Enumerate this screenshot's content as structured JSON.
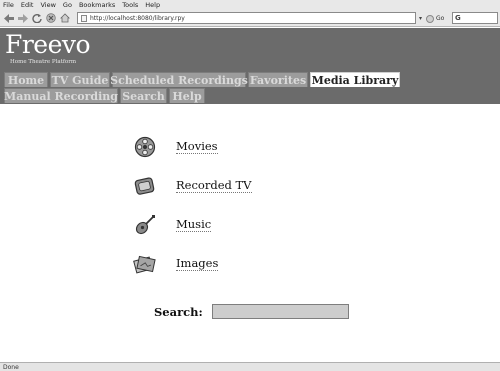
{
  "browser": {
    "menu": [
      "File",
      "Edit",
      "View",
      "Go",
      "Bookmarks",
      "Tools",
      "Help"
    ],
    "url": "http://localhost:8080/library.rpy",
    "go_label": "Go",
    "search_logo": "G",
    "status": "Done",
    "nav_icons": [
      "back-arrow-icon",
      "forward-arrow-icon",
      "reload-icon",
      "stop-icon",
      "home-icon"
    ]
  },
  "header": {
    "logo": "Freevo",
    "tagline": "Home Theatre Platform",
    "tabs_row1": [
      {
        "label": "Home",
        "active": false
      },
      {
        "label": "TV Guide",
        "active": false
      },
      {
        "label": "Scheduled Recordings",
        "active": false
      },
      {
        "label": "Favorites",
        "active": false
      },
      {
        "label": "Media Library",
        "active": true
      }
    ],
    "tabs_row2": [
      {
        "label": "Manual Recording",
        "active": false
      },
      {
        "label": "Search",
        "active": false
      },
      {
        "label": "Help",
        "active": false
      }
    ]
  },
  "library": {
    "items": [
      {
        "label": "Movies",
        "icon": "film-reel-icon"
      },
      {
        "label": "Recorded TV",
        "icon": "television-icon"
      },
      {
        "label": "Music",
        "icon": "guitar-icon"
      },
      {
        "label": "Images",
        "icon": "photos-icon"
      }
    ],
    "search_label": "Search:",
    "search_value": ""
  },
  "colors": {
    "header_bg": "#6b6b6b",
    "tab_bg": "#9c9c9c",
    "tab_active_bg": "#ffffff",
    "search_input_bg": "#cdcdcd"
  }
}
